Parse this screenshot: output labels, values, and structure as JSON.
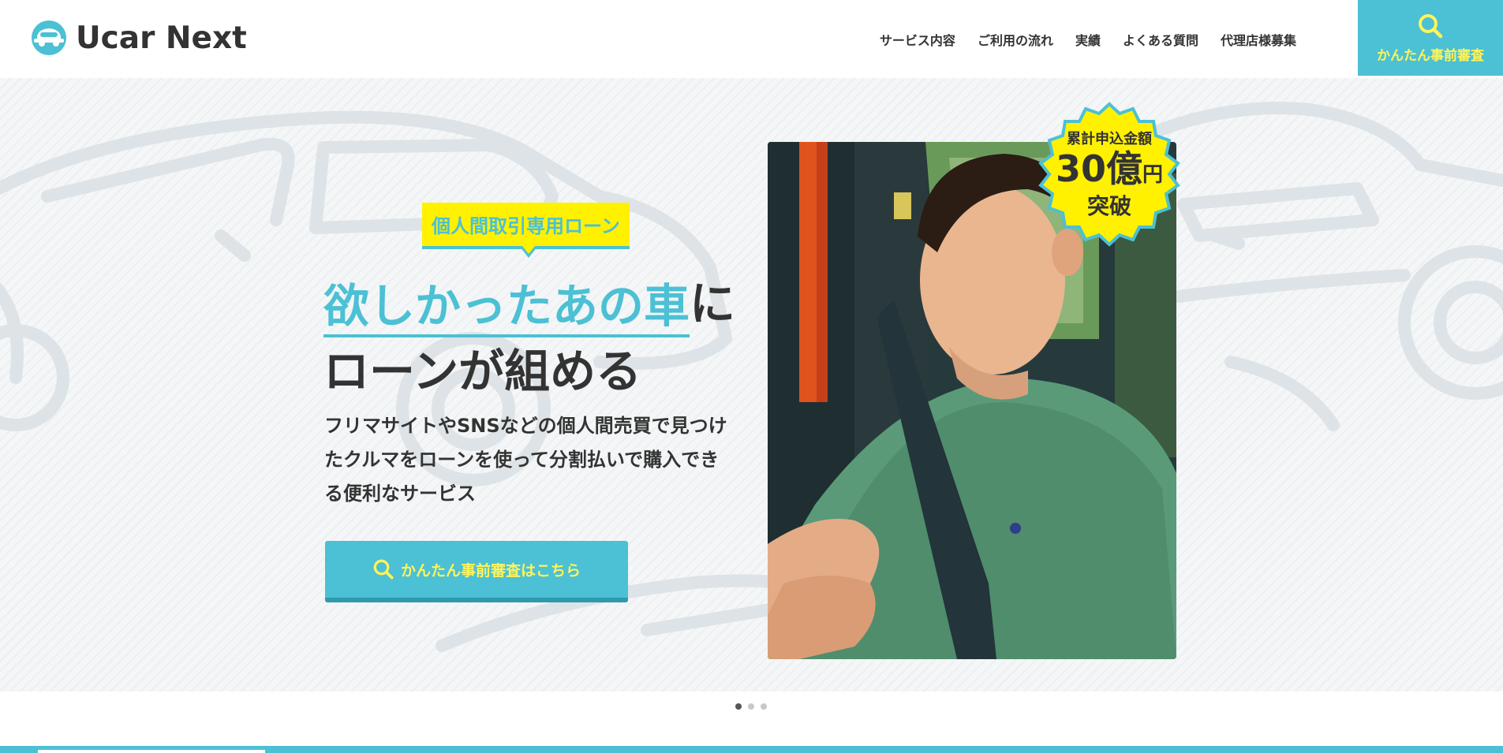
{
  "header": {
    "logo_text": "Ucar Next",
    "nav": [
      {
        "label": "サービス内容"
      },
      {
        "label": "ご利用の流れ"
      },
      {
        "label": "実績"
      },
      {
        "label": "よくある質問"
      },
      {
        "label": "代理店様募集"
      }
    ],
    "cta_label": "かんたん事前審査",
    "cta_icon": "search-icon"
  },
  "hero": {
    "tag": "個人間取引専用ローン",
    "headline_accent": "欲しかったあの車",
    "headline_rest": "に",
    "headline_line2": "ローンが組める",
    "description": "フリマサイトやSNSなどの個人間売買で見つけたクルマをローンを使って分割払いで購入できる便利なサービス",
    "cta_label": "かんたん事前審査はこちら",
    "cta_icon": "search-icon",
    "badge": {
      "line1": "累計申込金額",
      "number": "30億",
      "unit": "円",
      "line3": "突破"
    }
  },
  "slider": {
    "count": 3,
    "active": 1
  },
  "colors": {
    "accent": "#4cc0d4",
    "highlight": "#fff100",
    "cta_text": "#fff45a",
    "text": "#333333"
  }
}
